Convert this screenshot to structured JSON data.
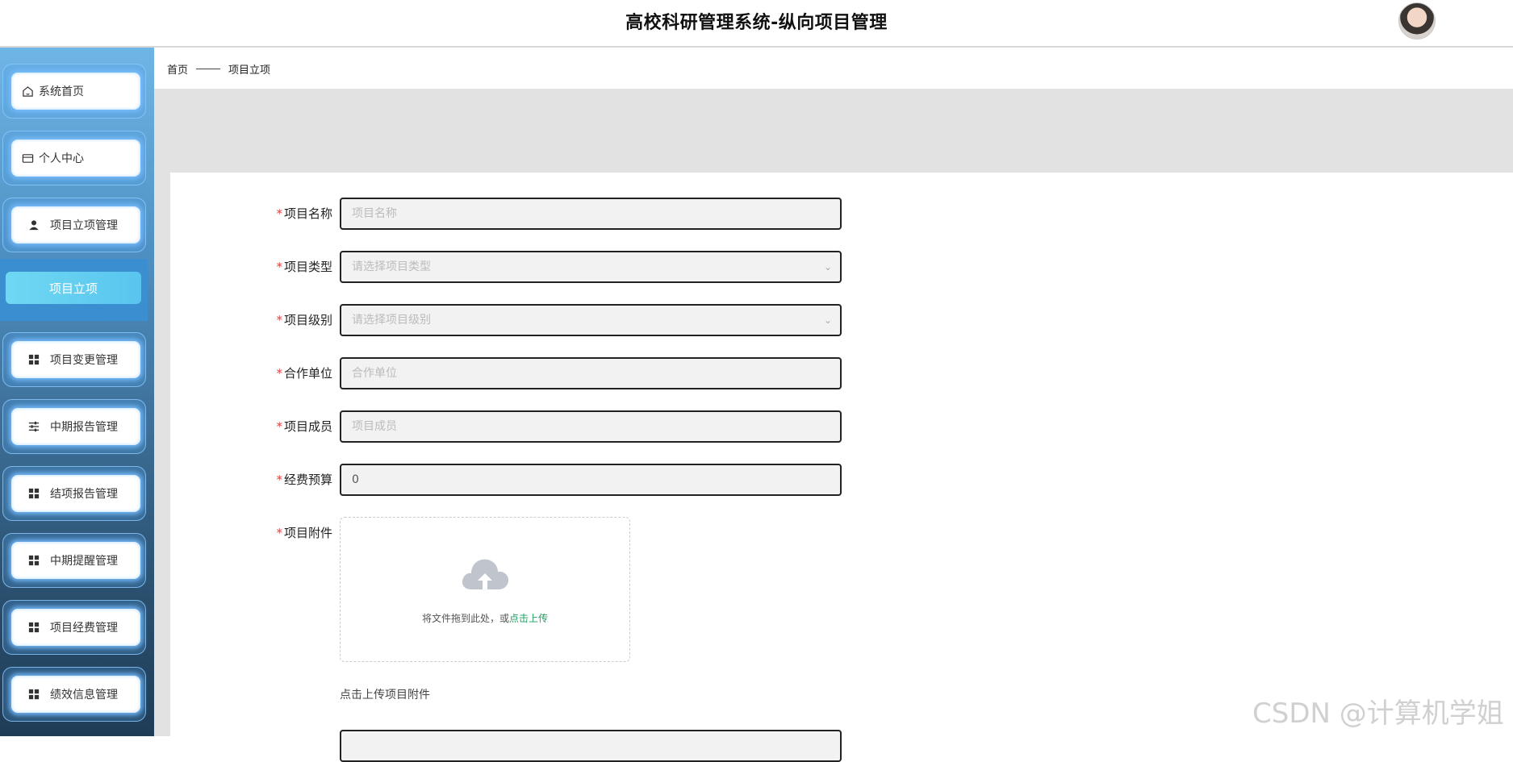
{
  "header": {
    "title": "高校科研管理系统-纵向项目管理"
  },
  "sidebar": {
    "items": [
      {
        "label": "系统首页",
        "icon": "home-icon"
      },
      {
        "label": "个人中心",
        "icon": "card-icon"
      },
      {
        "label": "项目立项管理",
        "icon": "user-icon"
      },
      {
        "label": "项目变更管理",
        "icon": "grid-icon"
      },
      {
        "label": "中期报告管理",
        "icon": "sliders-icon"
      },
      {
        "label": "结项报告管理",
        "icon": "grid-icon"
      },
      {
        "label": "中期提醒管理",
        "icon": "grid-icon"
      },
      {
        "label": "项目经费管理",
        "icon": "grid-icon"
      },
      {
        "label": "绩效信息管理",
        "icon": "grid-icon"
      }
    ],
    "active_sub": "项目立项"
  },
  "breadcrumb": {
    "home": "首页",
    "current": "项目立项"
  },
  "form": {
    "fields": [
      {
        "label": "项目名称",
        "placeholder": "项目名称",
        "value": ""
      },
      {
        "label": "项目类型",
        "placeholder": "请选择项目类型",
        "value": ""
      },
      {
        "label": "项目级别",
        "placeholder": "请选择项目级别",
        "value": ""
      },
      {
        "label": "合作单位",
        "placeholder": "合作单位",
        "value": ""
      },
      {
        "label": "项目成员",
        "placeholder": "项目成员",
        "value": ""
      },
      {
        "label": "经费预算",
        "placeholder": "",
        "value": "0"
      }
    ],
    "attachment": {
      "label": "项目附件",
      "hint_prefix": "将文件拖到此处，或",
      "hint_link": "点击上传",
      "tip": "点击上传项目附件"
    }
  },
  "watermark": "CSDN @计算机学姐"
}
